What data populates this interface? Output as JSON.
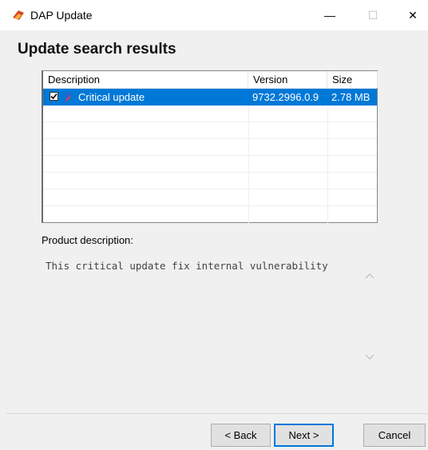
{
  "window": {
    "title": "DAP Update",
    "controls": {
      "minimize": "—",
      "maximize": "☐",
      "close": "✕"
    }
  },
  "page": {
    "heading": "Update search results"
  },
  "updates_table": {
    "columns": [
      "Description",
      "Version",
      "Size"
    ],
    "rows": [
      {
        "checked": true,
        "icon": "lightning-update-icon",
        "description": "Critical update",
        "version": "9732.2996.0.9",
        "size": "2.78 MB",
        "selected": true
      }
    ]
  },
  "product_description": {
    "label": "Product description:",
    "text": "This critical update fix internal vulnerability"
  },
  "buttons": {
    "back": "< Back",
    "next": "Next >",
    "cancel": "Cancel"
  },
  "colors": {
    "selection": "#0078d7",
    "background": "#ffffff",
    "panel": "#f0f0f0"
  }
}
